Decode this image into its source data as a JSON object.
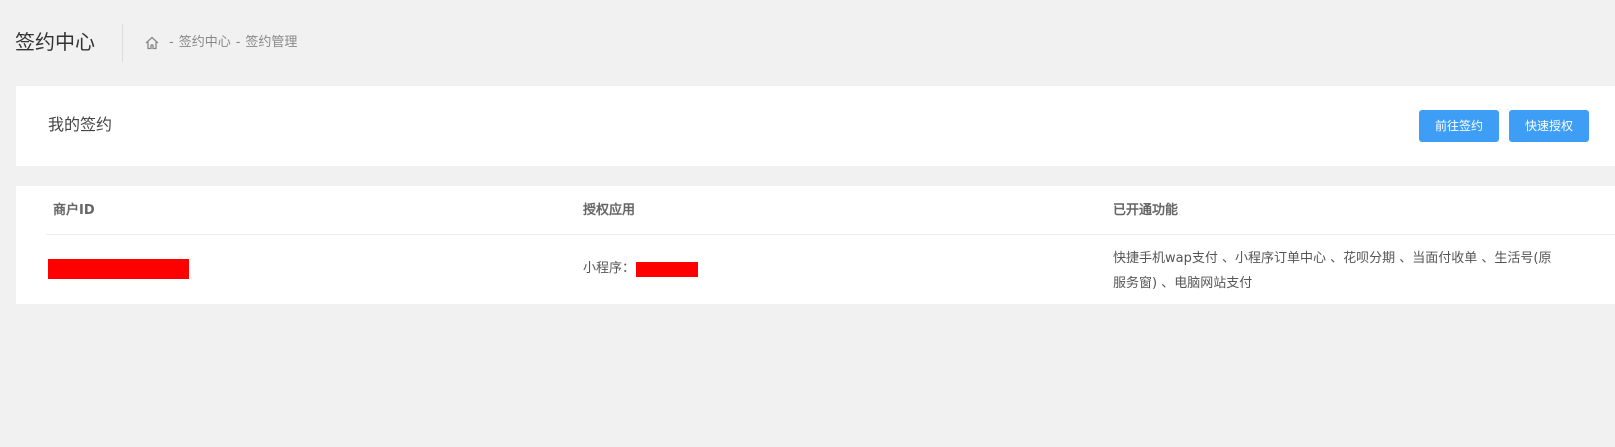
{
  "header": {
    "title": "签约中心",
    "breadcrumb": {
      "home_icon": "home-icon",
      "separator": "-",
      "items": [
        "签约中心",
        "签约管理"
      ]
    }
  },
  "signing_card": {
    "title": "我的签约",
    "buttons": {
      "go_sign_label": "前往签约",
      "quick_auth_label": "快速授权"
    },
    "accent_color": "#3e9ef5"
  },
  "table": {
    "columns": [
      "商户ID",
      "授权应用",
      "已开通功能"
    ],
    "rows": [
      {
        "authorized_app_prefix": "小程序：",
        "features_line1": "快捷手机wap支付 、小程序订单中心 、花呗分期 、当面付收单 、生活号(原",
        "features_line2": "服务窗) 、电脑网站支付"
      }
    ]
  },
  "colors": {
    "redaction": "#ff0000",
    "page_background": "#f1f1f1"
  }
}
